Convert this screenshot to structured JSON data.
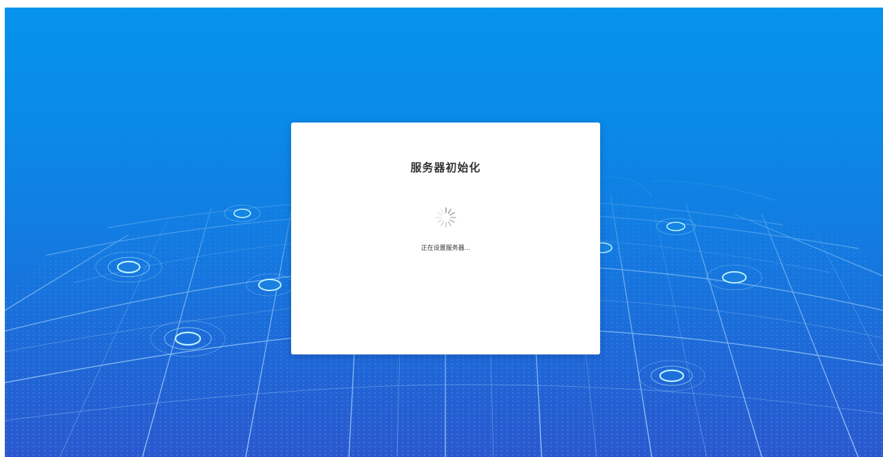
{
  "dialog": {
    "title": "服务器初始化",
    "status": "正在设置服务器..."
  },
  "icons": {
    "spinner": "loading-spinner-icon",
    "map_markers": "location-pin-icon"
  },
  "colors": {
    "background_top": "#0593ee",
    "background_bottom": "#2a58cf",
    "dialog_background": "#ffffff",
    "title_text": "#333333",
    "status_text": "#333333",
    "spinner": "#9a9a9a",
    "map_lines": "#bfe6ff"
  }
}
